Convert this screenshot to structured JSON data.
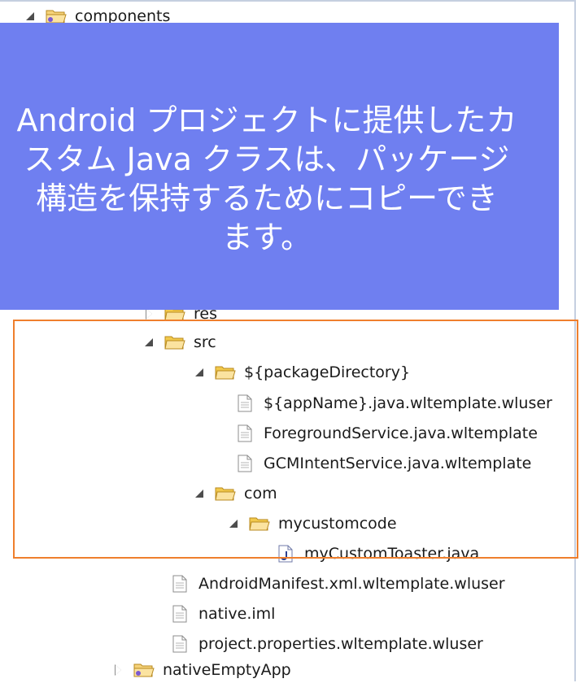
{
  "tree": {
    "items": [
      {
        "label": "components",
        "icon": "project-folder-icon"
      },
      {
        "label": "res",
        "icon": "folder-icon"
      },
      {
        "label": "src",
        "icon": "folder-icon"
      },
      {
        "label": "${packageDirectory}",
        "icon": "folder-icon"
      },
      {
        "label": "${appName}.java.wltemplate.wluser",
        "icon": "file-icon"
      },
      {
        "label": "ForegroundService.java.wltemplate",
        "icon": "file-icon"
      },
      {
        "label": "GCMIntentService.java.wltemplate",
        "icon": "file-icon"
      },
      {
        "label": "com",
        "icon": "folder-icon"
      },
      {
        "label": "mycustomcode",
        "icon": "folder-icon"
      },
      {
        "label": "myCustomToaster.java",
        "icon": "java-file-icon"
      },
      {
        "label": "AndroidManifest.xml.wltemplate.wluser",
        "icon": "file-icon"
      },
      {
        "label": "native.iml",
        "icon": "file-icon"
      },
      {
        "label": "project.properties.wltemplate.wluser",
        "icon": "file-icon"
      },
      {
        "label": "nativeEmptyApp",
        "icon": "project-folder-icon"
      }
    ]
  },
  "callout": {
    "lines": [
      "Android プロジェクトに提供したカ",
      "スタム Java クラスは、パッケージ",
      "構造を保持するためにコピーでき",
      "ます。"
    ]
  },
  "colors": {
    "callout_bg": "#6f7ff0",
    "highlight_border": "#ef7f2d",
    "folder": "#f2c94c"
  }
}
